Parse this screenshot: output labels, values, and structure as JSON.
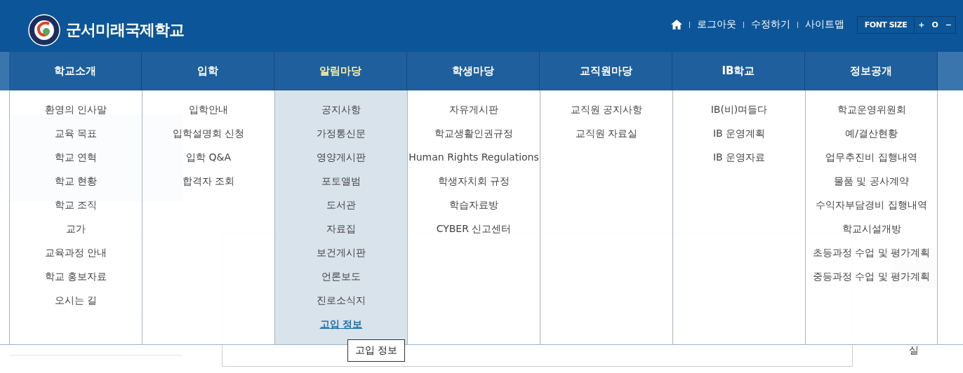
{
  "header": {
    "school_name": "군서미래국제학교",
    "links": [
      "로그아웃",
      "수정하기",
      "사이트맵"
    ],
    "font_size": {
      "label": "FONT SIZE",
      "buttons": [
        "+",
        "O",
        "−"
      ]
    }
  },
  "menu": [
    {
      "label": "학교소개",
      "selected": false,
      "items": [
        {
          "label": "환영의 인사말",
          "current": false
        },
        {
          "label": "교육 목표",
          "current": false
        },
        {
          "label": "학교 연혁",
          "current": false
        },
        {
          "label": "학교 현황",
          "current": false
        },
        {
          "label": "학교 조직",
          "current": false
        },
        {
          "label": "교가",
          "current": false
        },
        {
          "label": "교육과정 안내",
          "current": false
        },
        {
          "label": "학교 홍보자료",
          "current": false
        },
        {
          "label": "오시는 길",
          "current": false
        }
      ]
    },
    {
      "label": "입학",
      "selected": false,
      "items": [
        {
          "label": "입학안내",
          "current": false
        },
        {
          "label": "입학설명회 신청",
          "current": false
        },
        {
          "label": "입학 Q&A",
          "current": false
        },
        {
          "label": "합격자 조회",
          "current": false
        }
      ]
    },
    {
      "label": "알림마당",
      "selected": true,
      "items": [
        {
          "label": "공지사항",
          "current": false
        },
        {
          "label": "가정통신문",
          "current": false
        },
        {
          "label": "영양게시판",
          "current": false
        },
        {
          "label": "포토앨범",
          "current": false
        },
        {
          "label": "도서관",
          "current": false
        },
        {
          "label": "자료집",
          "current": false
        },
        {
          "label": "보건게시판",
          "current": false
        },
        {
          "label": "언론보도",
          "current": false
        },
        {
          "label": "진로소식지",
          "current": false
        },
        {
          "label": "고입 정보",
          "current": true
        }
      ]
    },
    {
      "label": "학생마당",
      "selected": false,
      "items": [
        {
          "label": "자유게시판",
          "current": false
        },
        {
          "label": "학교생활인권규정",
          "current": false
        },
        {
          "label": "Human Rights Regulations",
          "current": false
        },
        {
          "label": "학생자치회 규정",
          "current": false
        },
        {
          "label": "학습자료방",
          "current": false
        },
        {
          "label": "CYBER 신고센터",
          "current": false
        }
      ]
    },
    {
      "label": "교직원마당",
      "selected": false,
      "items": [
        {
          "label": "교직원 공지사항",
          "current": false
        },
        {
          "label": "교직원 자료실",
          "current": false
        }
      ]
    },
    {
      "label": "IB학교",
      "selected": false,
      "items": [
        {
          "label": "IB(비)며들다",
          "current": false
        },
        {
          "label": "IB 운영계획",
          "current": false
        },
        {
          "label": "IB 운영자료",
          "current": false
        }
      ]
    },
    {
      "label": "정보공개",
      "selected": false,
      "items": [
        {
          "label": "학교운영위원회",
          "current": false
        },
        {
          "label": "예/결산현황",
          "current": false
        },
        {
          "label": "업무추진비 집행내역",
          "current": false
        },
        {
          "label": "물품 및 공사계약",
          "current": false
        },
        {
          "label": "수익자부담경비 집행내역",
          "current": false
        },
        {
          "label": "학교시설개방",
          "current": false
        },
        {
          "label": "초등과정 수업 및 평가계획",
          "current": false
        },
        {
          "label": "중등과정 수업 및 평가계획",
          "current": false
        }
      ]
    }
  ],
  "page": {
    "quick_menu_link": "실"
  },
  "tooltip": "고입 정보"
}
